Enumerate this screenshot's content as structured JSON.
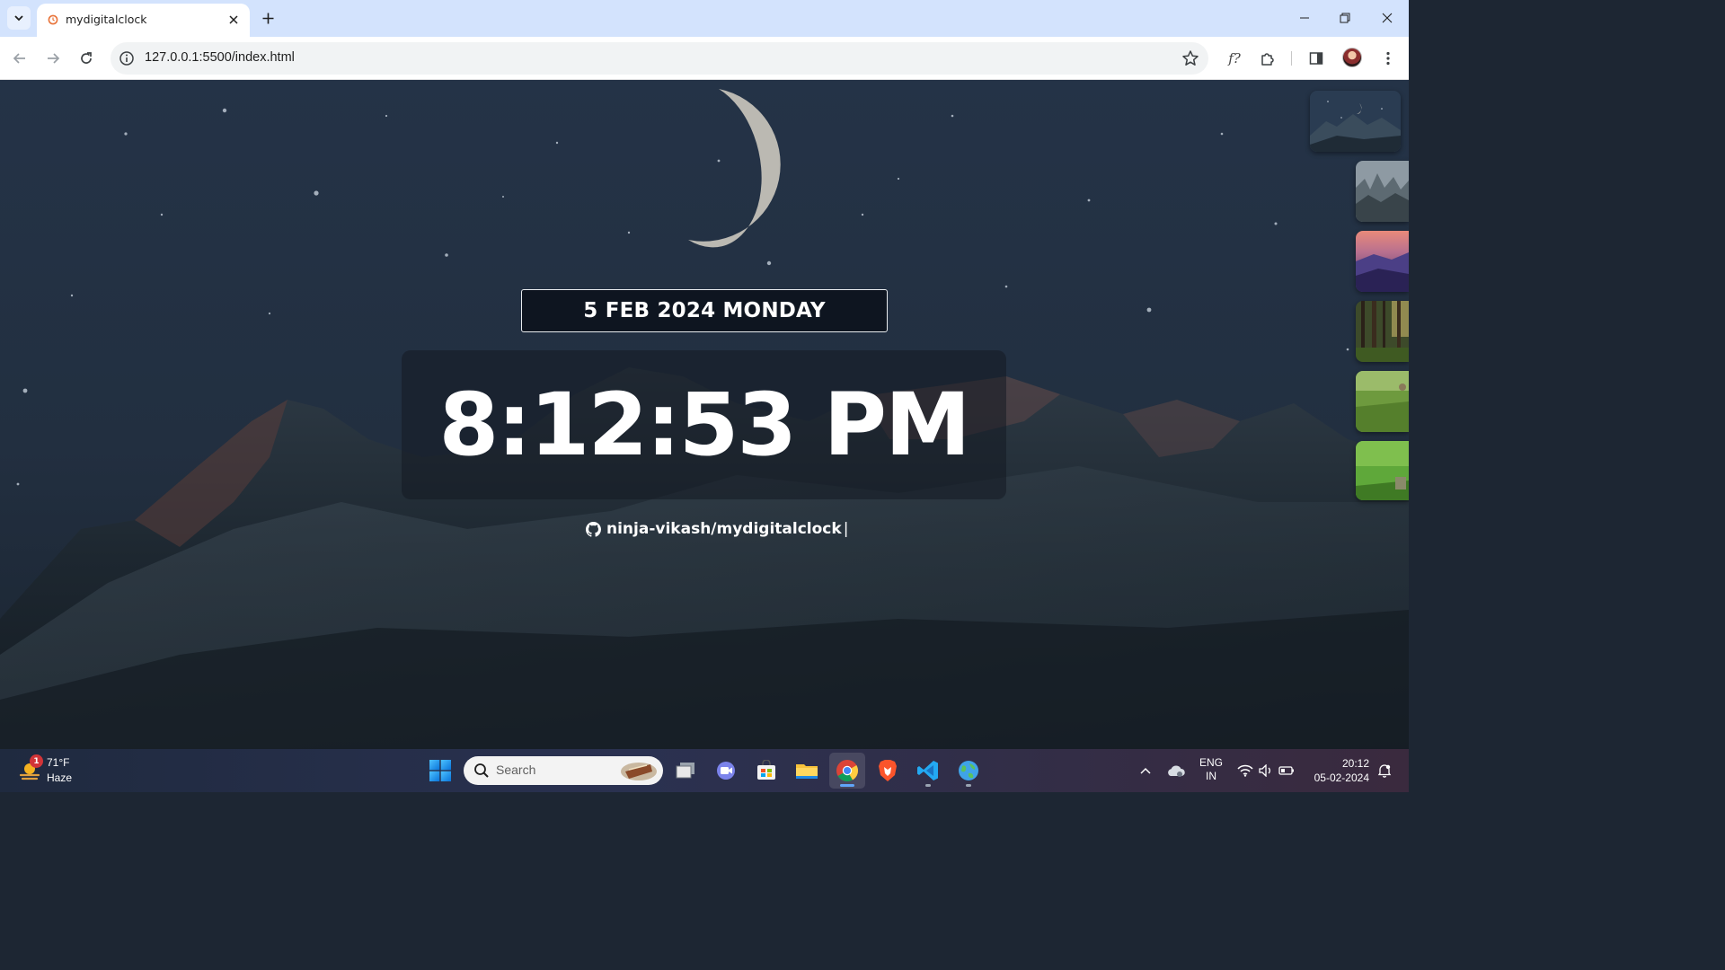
{
  "browser": {
    "tab_title": "mydigitalclock",
    "url": "127.0.0.1:5500/index.html"
  },
  "page": {
    "date": "5 FEB 2024 MONDAY",
    "time": "8:12:53 PM",
    "github_link": "ninja-vikash/mydigitalclock",
    "cursor": "|",
    "background_color": "#1d2633",
    "thumbnails": [
      {
        "name": "night-mountain-moon"
      },
      {
        "name": "misty-forest"
      },
      {
        "name": "purple-sunset-hills"
      },
      {
        "name": "forest-trees"
      },
      {
        "name": "green-meadow"
      },
      {
        "name": "green-field"
      }
    ]
  },
  "taskbar": {
    "weather_badge": "1",
    "weather_temp": "71°F",
    "weather_condition": "Haze",
    "search_label": "Search",
    "lang_line1": "ENG",
    "lang_line2": "IN",
    "time": "20:12",
    "date": "05-02-2024"
  },
  "icons": [
    "tab-search-icon",
    "close-icon",
    "plus-icon",
    "minimize-icon",
    "restore-icon",
    "back-icon",
    "forward-icon",
    "reload-icon",
    "info-icon",
    "star-icon",
    "extensions-icon",
    "sidepanel-icon",
    "menu-icon",
    "github-icon",
    "windows-start-icon",
    "search-icon",
    "chevron-up-icon",
    "wifi-icon",
    "volume-icon",
    "battery-icon",
    "notification-icon"
  ]
}
